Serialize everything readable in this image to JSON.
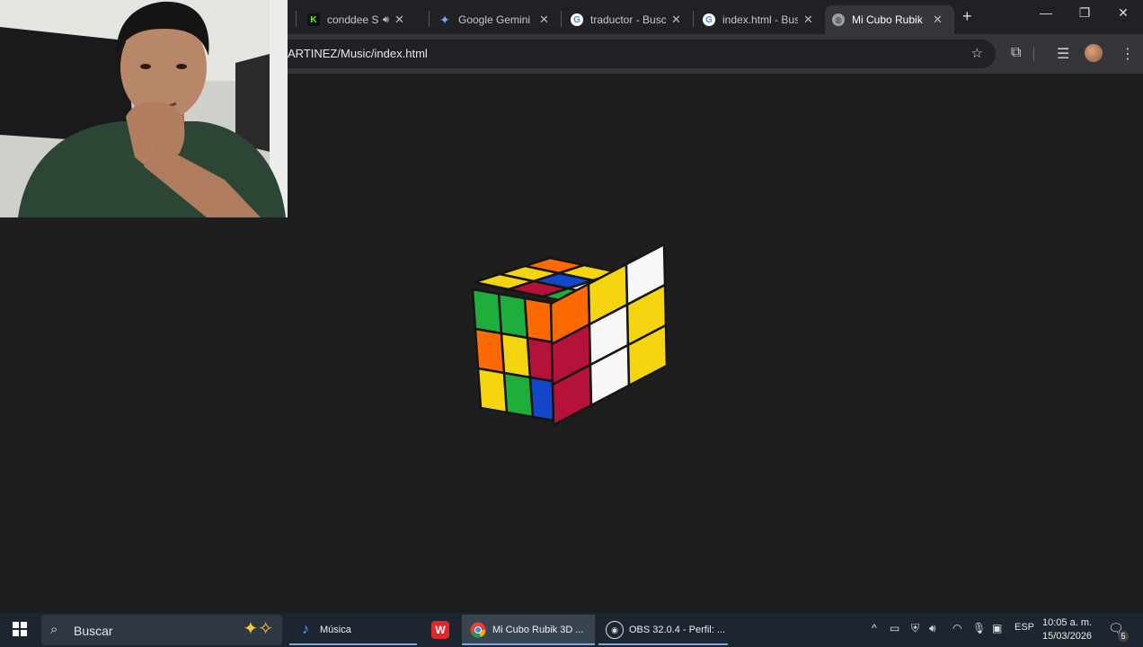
{
  "browser": {
    "tabs": [
      {
        "label": "conddee Str",
        "icon": "kick-icon",
        "has_sound": true
      },
      {
        "label": "Google Gemini",
        "icon": "gemini-icon"
      },
      {
        "label": "traductor - Busc",
        "icon": "google-icon"
      },
      {
        "label": "index.html - Busc",
        "icon": "google-icon"
      },
      {
        "label": "Mi Cubo Rubik",
        "icon": "globe-icon",
        "active": true
      }
    ],
    "new_tab_symbol": "+",
    "window_controls": {
      "minimize": "—",
      "restore": "❐",
      "close": "✕"
    },
    "url": "ARTINEZ/Music/index.html"
  },
  "cube": {
    "colors": {
      "green": "#1fae3c",
      "yellow": "#f5d410",
      "orange": "#ff6a00",
      "red": "#b5123a",
      "blue": "#1446c8",
      "white": "#f7f7f7"
    }
  },
  "taskbar": {
    "search_placeholder": "Buscar",
    "apps": [
      {
        "label": "Música",
        "icon": "music-icon"
      },
      {
        "label": "",
        "icon": "wps-office-icon"
      },
      {
        "label": "Mi Cubo Rubik 3D ...",
        "icon": "chrome-icon",
        "active": true
      },
      {
        "label": "OBS 32.0.4 - Perfil: ...",
        "icon": "obs-icon"
      }
    ],
    "language": "ESP",
    "time": "10:05 a. m.",
    "date": "15/03/2026",
    "notification_count": "5"
  }
}
